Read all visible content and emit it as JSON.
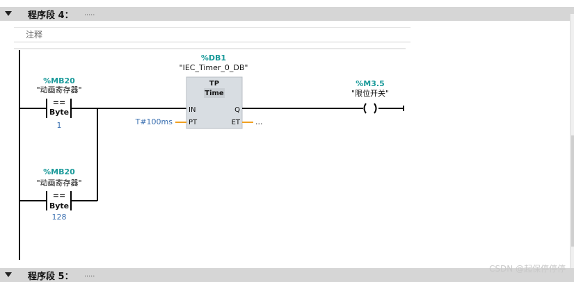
{
  "segment4": {
    "title": "程序段 4：",
    "dots": "....."
  },
  "comment": "注释",
  "contact1": {
    "address": "%MB20",
    "name": "\"动画寄存器\"",
    "op": "==",
    "type": "Byte",
    "value": "1"
  },
  "contact2": {
    "address": "%MB20",
    "name": "\"动画寄存器\"",
    "op": "==",
    "type": "Byte",
    "value": "128"
  },
  "timer": {
    "db": "%DB1",
    "instance": "\"IEC_Timer_0_DB\"",
    "kind": "TP",
    "type": "Time",
    "in_label": "IN",
    "pt_label": "PT",
    "q_label": "Q",
    "et_label": "ET",
    "pt_value": "T#100ms",
    "et_value": "..."
  },
  "coil": {
    "address": "%M3.5",
    "name": "\"限位开关\""
  },
  "segment5": {
    "title": "程序段 5：",
    "dots": "....."
  },
  "watermark": "CSDN @起保停停停",
  "colors": {
    "address": "#1a9a9a",
    "value": "#3a6fb0",
    "wire": "#000000",
    "pin": "#f0a020",
    "box": "#d8dde2"
  }
}
